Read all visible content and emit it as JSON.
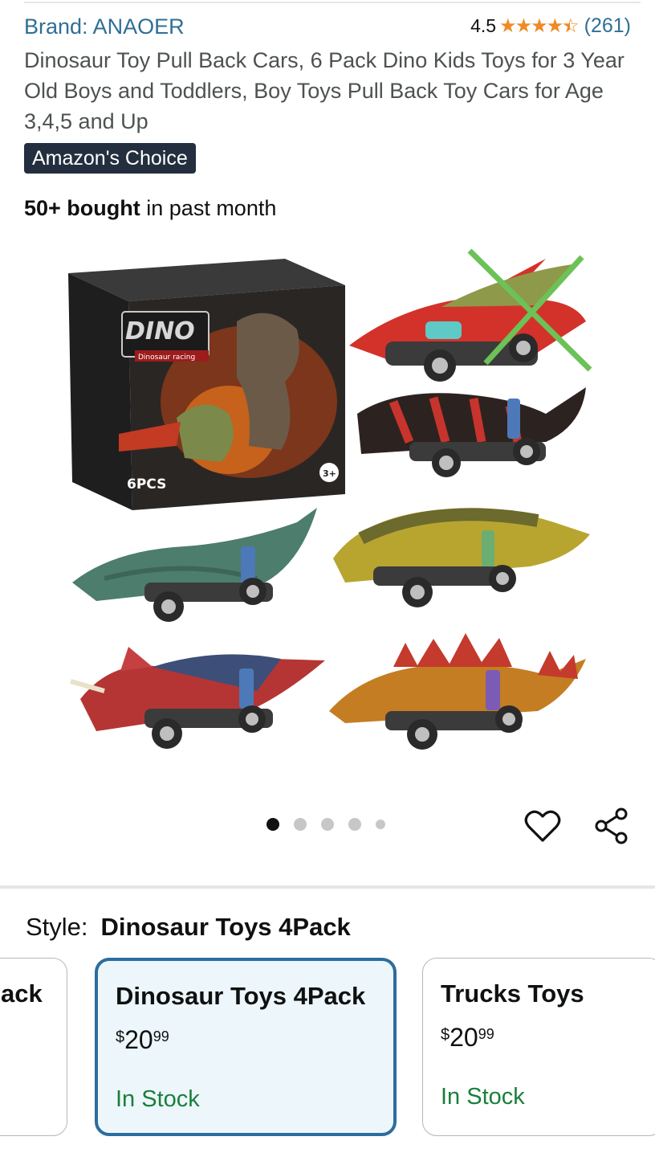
{
  "product": {
    "brand": "Brand: ANAOER",
    "rating_value": "4.5",
    "stars": 4.5,
    "rating_count": "(261)",
    "title": "Dinosaur Toy Pull Back Cars, 6 Pack Dino Kids Toys for 3 Year Old Boys and Toddlers, Boy Toys Pull Back Toy Cars for Age 3,4,5 and Up",
    "badge": "Amazon's Choice",
    "bought_bold": "50+ bought",
    "bought_rest": " in past month"
  },
  "gallery": {
    "box_logo": "DINO",
    "box_sub": "Dinosaur racing",
    "box_count": "6PCS",
    "box_age": "3+",
    "image_count": 5,
    "active_index": 0
  },
  "actions": {
    "favorite_icon": "heart-icon",
    "share_icon": "share-icon"
  },
  "style": {
    "label": "Style:",
    "selected": "Dinosaur Toys 4Pack",
    "options": [
      {
        "name": "ack",
        "cur": "",
        "whole": "",
        "frac": "",
        "stock": ""
      },
      {
        "name": "Dinosaur Toys 4Pack",
        "cur": "$",
        "whole": "20",
        "frac": "99",
        "stock": "In Stock"
      },
      {
        "name": "Trucks Toys",
        "cur": "$",
        "whole": "20",
        "frac": "99",
        "stock": "In Stock"
      }
    ]
  },
  "colors": {
    "link": "#2f6f95",
    "star": "#f08a24",
    "badge_bg": "#232f3e",
    "selected_border": "#2c6d9e",
    "in_stock": "#1a7f3c"
  }
}
